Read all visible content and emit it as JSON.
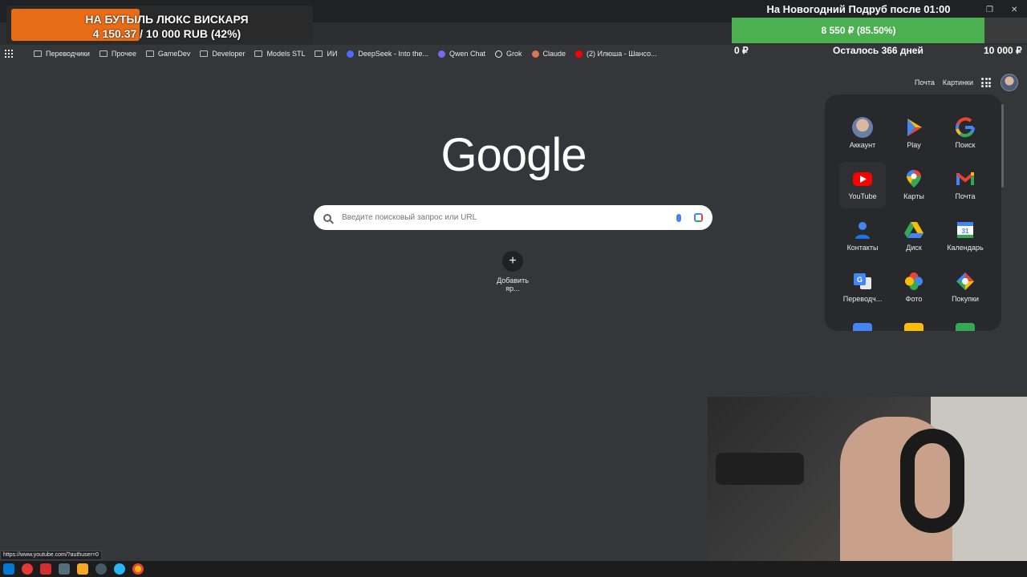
{
  "donation_goal": {
    "title": "НА БУТЫЛЬ ЛЮКС ВИСКАРЯ",
    "progress_text": "4 150.37 / 10 000 RUB (42%)",
    "progress_fraction": 0.42
  },
  "stream_goal": {
    "title": "На Новогодний Подруб после 01:00",
    "bar_label": "8 550 ₽ (85.50%)",
    "progress_fraction": 0.855,
    "min_label": "0 ₽",
    "remaining_label": "Осталось 366 дней",
    "max_label": "10 000 ₽"
  },
  "bookmarks": [
    {
      "label": "Переводчики",
      "icon": "folder-icon"
    },
    {
      "label": "Прочее",
      "icon": "folder-icon"
    },
    {
      "label": "GameDev",
      "icon": "folder-icon"
    },
    {
      "label": "Developer",
      "icon": "folder-icon"
    },
    {
      "label": "Models STL",
      "icon": "folder-icon"
    },
    {
      "label": "ИИ",
      "icon": "folder-icon"
    },
    {
      "label": "DeepSeek - Into the...",
      "icon": "deepseek-icon"
    },
    {
      "label": "Qwen Chat",
      "icon": "qwen-icon"
    },
    {
      "label": "Grok",
      "icon": "grok-icon"
    },
    {
      "label": "Claude",
      "icon": "claude-icon"
    },
    {
      "label": "(2) Илюша - Шансо...",
      "icon": "youtube-icon"
    }
  ],
  "header": {
    "mail_link": "Почта",
    "images_link": "Картинки"
  },
  "logo_text": "Google",
  "search": {
    "placeholder": "Введите поисковый запрос или URL"
  },
  "shortcut": {
    "plus": "+",
    "label": "Добавить яр..."
  },
  "apps_panel": {
    "apps": [
      {
        "label": "Аккаунт",
        "icon": "account-icon"
      },
      {
        "label": "Play",
        "icon": "play-icon"
      },
      {
        "label": "Поиск",
        "icon": "google-search-icon"
      },
      {
        "label": "YouTube",
        "icon": "youtube-icon"
      },
      {
        "label": "Карты",
        "icon": "maps-icon"
      },
      {
        "label": "Почта",
        "icon": "gmail-icon"
      },
      {
        "label": "Контакты",
        "icon": "contacts-icon"
      },
      {
        "label": "Диск",
        "icon": "drive-icon"
      },
      {
        "label": "Календарь",
        "icon": "calendar-icon"
      },
      {
        "label": "Переводч...",
        "icon": "translate-icon"
      },
      {
        "label": "Фото",
        "icon": "photos-icon"
      },
      {
        "label": "Покупки",
        "icon": "shopping-icon"
      }
    ],
    "calendar_day": "31"
  },
  "status_url": "https://www.youtube.com/?authuser=0"
}
